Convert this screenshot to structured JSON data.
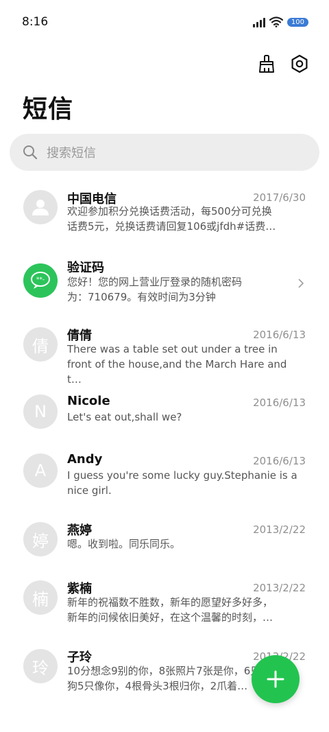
{
  "status_bar": {
    "time": "8:16",
    "battery": "100"
  },
  "header": {
    "title": "短信"
  },
  "search": {
    "placeholder": "搜索短信"
  },
  "messages": [
    {
      "name": "中国电信",
      "date": "2017/6/30",
      "line1": "欢迎参加积分兑换话费活动，每500分可兑换",
      "line2": "话费5元，兑换话费请回复106或jfdh#话费…",
      "avatar_text": ""
    },
    {
      "name": "验证码",
      "date": "",
      "line1": "您好！您的网上营业厅登录的随机密码",
      "line2": "为：710679。有效时间为3分钟",
      "avatar_text": ""
    },
    {
      "name": "倩倩",
      "date": "2016/6/13",
      "line1": "There was a table set out under a tree in",
      "line2": "front of the house,and the March Hare and t…",
      "avatar_text": "倩"
    },
    {
      "name": "Nicole",
      "date": "2016/6/13",
      "line1": "Let's eat out,shall we?",
      "line2": "",
      "avatar_text": "N"
    },
    {
      "name": "Andy",
      "date": "2016/6/13",
      "line1": "I guess you're some lucky guy.Stephanie is a",
      "line2": "nice girl.",
      "avatar_text": "A"
    },
    {
      "name": "燕婷",
      "date": "2013/2/22",
      "line1": "嗯。收到啦。同乐同乐。",
      "line2": "",
      "avatar_text": "婷"
    },
    {
      "name": "紫楠",
      "date": "2013/2/22",
      "line1": "新年的祝福数不胜数，新年的愿望好多好多，",
      "line2": "新年的问候依旧美好，在这个温馨的时刻，…",
      "avatar_text": "楠"
    },
    {
      "name": "子玲",
      "date": "2013/2/22",
      "line1": "10分想念9别的你，8张照片7张是你，6只",
      "line2": "狗5只像你，4根骨头3根归你，2爪着…",
      "avatar_text": "玲"
    }
  ],
  "colors": {
    "accent": "#22c44f",
    "avatar_gray": "#e4e4e4",
    "search_bg": "#ededed"
  }
}
